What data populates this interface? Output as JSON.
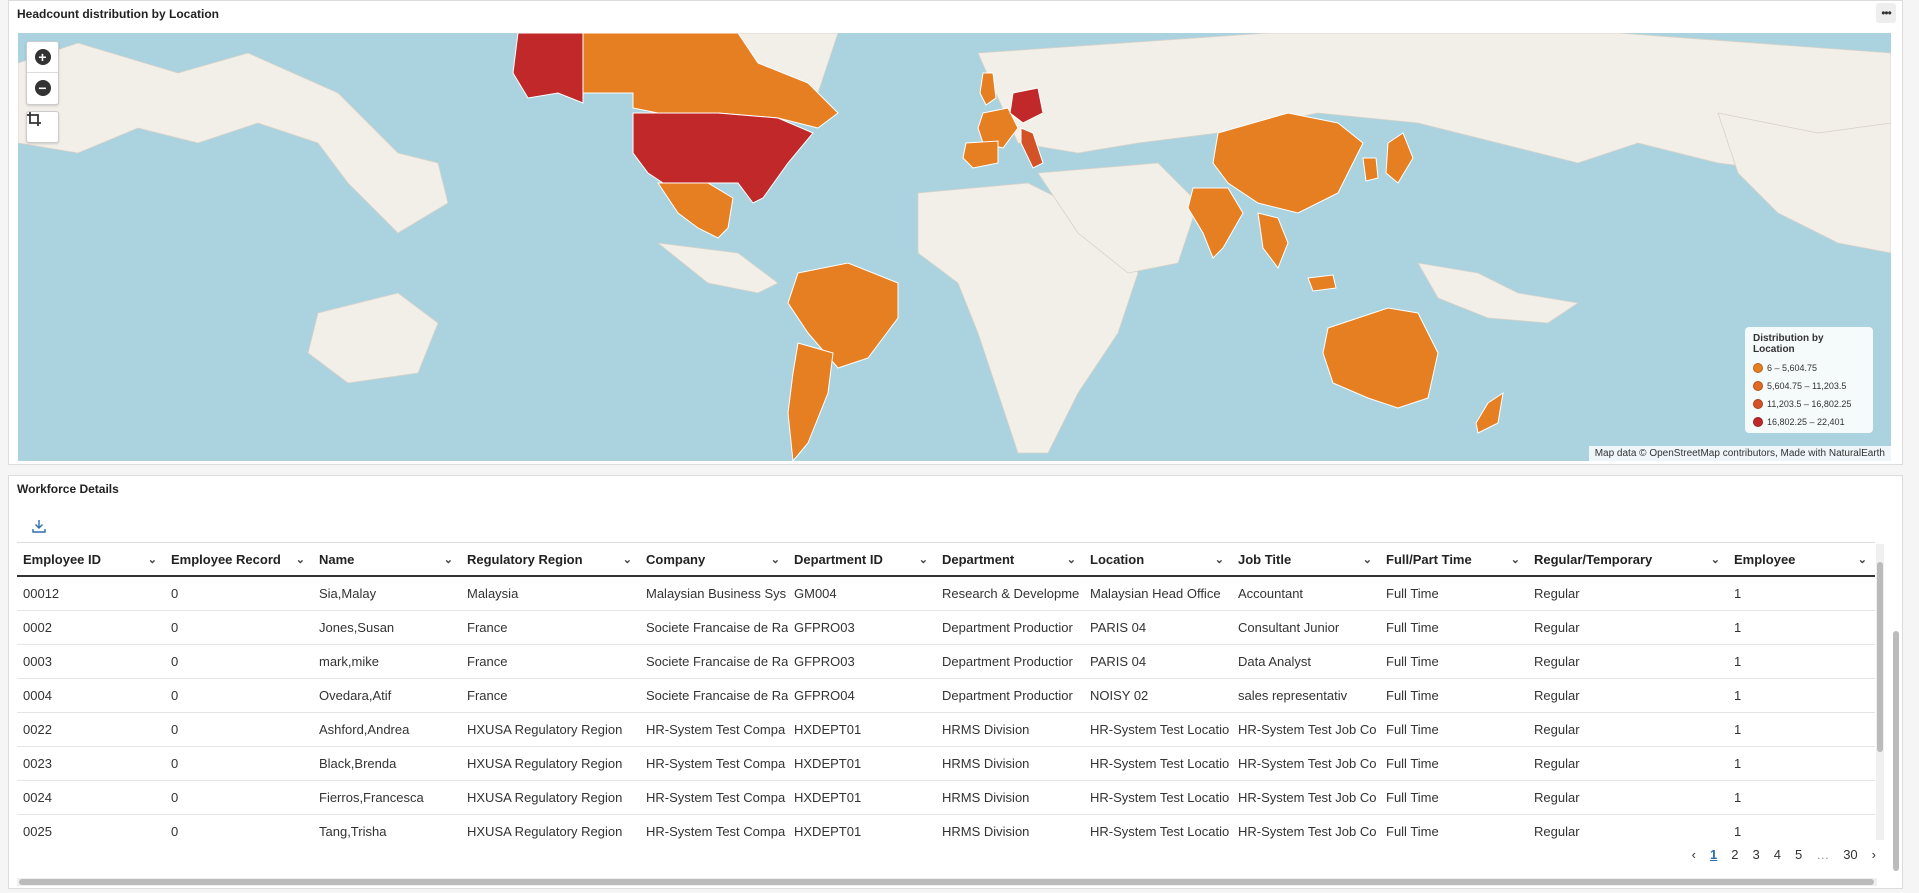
{
  "map_panel": {
    "title": "Headcount distribution by Location",
    "menu_icon": "ellipsis-icon",
    "legend": {
      "title": "Distribution by Location",
      "items": [
        {
          "label": "6 – 5,604.75",
          "color": "#e67e22"
        },
        {
          "label": "5,604.75 – 11,203.5",
          "color": "#e06a22"
        },
        {
          "label": "11,203.5 – 16,802.25",
          "color": "#d45227"
        },
        {
          "label": "16,802.25 – 22,401",
          "color": "#c0282a"
        }
      ]
    },
    "attribution": "Map data © OpenStreetMap contributors, Made with NaturalEarth",
    "colors": {
      "water": "#aad3df",
      "land": "#f2efe9",
      "low": "#e67e22",
      "high": "#c0282a"
    }
  },
  "table_panel": {
    "title": "Workforce Details",
    "columns": [
      "Employee ID",
      "Employee Record",
      "Name",
      "Regulatory Region",
      "Company",
      "Department ID",
      "Department",
      "Location",
      "Job Title",
      "Full/Part Time",
      "Regular/Temporary",
      "Employee"
    ],
    "rows": [
      [
        "00012",
        "0",
        "Sia,Malay",
        "Malaysia",
        "Malaysian Business Sys",
        "GM004",
        "Research & Developme",
        "Malaysian Head Office",
        "Accountant",
        "Full Time",
        "Regular",
        "1"
      ],
      [
        "0002",
        "0",
        "Jones,Susan",
        "France",
        "Societe Francaise de Ra",
        "GFPRO03",
        "Department Productior",
        "PARIS 04",
        "Consultant Junior",
        "Full Time",
        "Regular",
        "1"
      ],
      [
        "0003",
        "0",
        "mark,mike",
        "France",
        "Societe Francaise de Ra",
        "GFPRO03",
        "Department Productior",
        "PARIS 04",
        "Data Analyst",
        "Full Time",
        "Regular",
        "1"
      ],
      [
        "0004",
        "0",
        "Ovedara,Atif",
        "France",
        "Societe Francaise de Ra",
        "GFPRO04",
        "Department Productior",
        "NOISY 02",
        "sales representativ",
        "Full Time",
        "Regular",
        "1"
      ],
      [
        "0022",
        "0",
        "Ashford,Andrea",
        "HXUSA Regulatory Region",
        "HR-System Test Compa",
        "HXDEPT01",
        "HRMS Division",
        "HR-System Test Locatio",
        "HR-System Test Job Co",
        "Full Time",
        "Regular",
        "1"
      ],
      [
        "0023",
        "0",
        "Black,Brenda",
        "HXUSA Regulatory Region",
        "HR-System Test Compa",
        "HXDEPT01",
        "HRMS Division",
        "HR-System Test Locatio",
        "HR-System Test Job Co",
        "Full Time",
        "Regular",
        "1"
      ],
      [
        "0024",
        "0",
        "Fierros,Francesca",
        "HXUSA Regulatory Region",
        "HR-System Test Compa",
        "HXDEPT01",
        "HRMS Division",
        "HR-System Test Locatio",
        "HR-System Test Job Co",
        "Full Time",
        "Regular",
        "1"
      ],
      [
        "0025",
        "0",
        "Tang,Trisha",
        "HXUSA Regulatory Region",
        "HR-System Test Compa",
        "HXDEPT01",
        "HRMS Division",
        "HR-System Test Locatio",
        "HR-System Test Job Co",
        "Full Time",
        "Regular",
        "1"
      ]
    ],
    "pagination": {
      "pages": [
        "1",
        "2",
        "3",
        "4",
        "5"
      ],
      "ellipsis": "…",
      "last": "30",
      "current": "1"
    }
  }
}
